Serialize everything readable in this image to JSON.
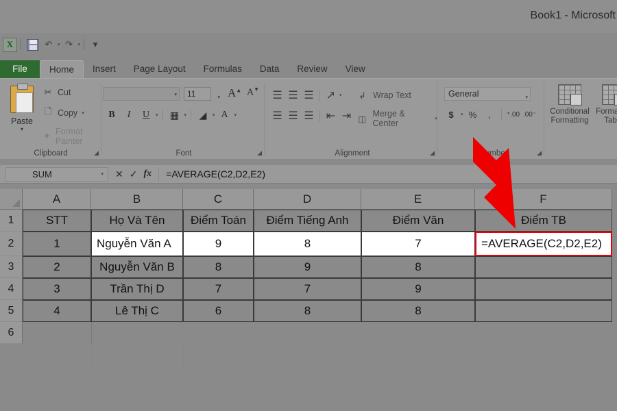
{
  "window": {
    "title": "Book1 - Microsoft"
  },
  "quick_access": {
    "excel_logo": "X",
    "save_icon": "save-icon",
    "undo_icon": "↶",
    "redo_icon": "↷",
    "customize_icon": "▾"
  },
  "ribbon": {
    "tabs": [
      {
        "label": "File",
        "active": false
      },
      {
        "label": "Home",
        "active": true
      },
      {
        "label": "Insert",
        "active": false
      },
      {
        "label": "Page Layout",
        "active": false
      },
      {
        "label": "Formulas",
        "active": false
      },
      {
        "label": "Data",
        "active": false
      },
      {
        "label": "Review",
        "active": false
      },
      {
        "label": "View",
        "active": false
      }
    ],
    "groups": {
      "clipboard": {
        "label": "Clipboard",
        "paste": "Paste",
        "cut": "Cut",
        "copy": "Copy",
        "format_painter": "Format Painter"
      },
      "font": {
        "label": "Font",
        "font_name": "",
        "font_size": "11",
        "bold": "B",
        "italic": "I",
        "underline": "U",
        "grow_font": "A",
        "shrink_font": "A"
      },
      "alignment": {
        "label": "Alignment",
        "wrap_text": "Wrap Text",
        "merge_center": "Merge & Center"
      },
      "number": {
        "label": "Number",
        "format": "General",
        "currency": "$",
        "percent": "%",
        "comma": ",",
        "increase_decimal": "⁺₀₀",
        "decrease_decimal": "₀₀⁻"
      },
      "styles": {
        "conditional_formatting": "Conditional\nFormatting",
        "format_as_table": "Format as\nTable"
      }
    }
  },
  "formula_bar": {
    "name_box": "SUM",
    "cancel_icon": "✕",
    "enter_icon": "✓",
    "function_icon": "fx",
    "formula": "=AVERAGE(C2,D2,E2)"
  },
  "sheet": {
    "column_headers": [
      "A",
      "B",
      "C",
      "D",
      "E",
      "F"
    ],
    "row_headers": [
      "1",
      "2",
      "3",
      "4",
      "5",
      "6"
    ],
    "rows": [
      {
        "row": "1",
        "A": "STT",
        "B": "Họ Và Tên",
        "C": "Điểm Toán",
        "D": "Điểm Tiếng Anh",
        "E": "Điểm Văn",
        "F": "Điểm TB"
      },
      {
        "row": "2",
        "A": "1",
        "B": "Nguyễn Văn A",
        "C": "9",
        "D": "8",
        "E": "7",
        "F": "=AVERAGE(C2,D2,E2)"
      },
      {
        "row": "3",
        "A": "2",
        "B": "Nguyễn Văn B",
        "C": "8",
        "D": "9",
        "E": "8",
        "F": ""
      },
      {
        "row": "4",
        "A": "3",
        "B": "Trần Thị D",
        "C": "7",
        "D": "7",
        "E": "9",
        "F": ""
      },
      {
        "row": "5",
        "A": "4",
        "B": "Lê Thị C",
        "C": "6",
        "D": "8",
        "E": "8",
        "F": ""
      },
      {
        "row": "6",
        "A": "",
        "B": "",
        "C": "",
        "D": "",
        "E": "",
        "F": ""
      }
    ],
    "active_cell": "F2"
  },
  "annotation": {
    "arrow_color": "#ee0000",
    "points_to": "F2"
  }
}
